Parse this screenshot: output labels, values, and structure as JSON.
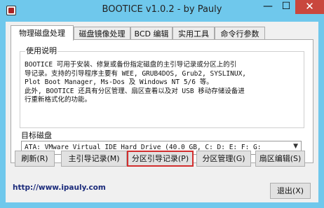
{
  "window": {
    "title": "BOOTICE v1.0.2 - by Pauly",
    "controls": {
      "minimize": "—",
      "maximize": "☐",
      "close": "✕"
    }
  },
  "tabs": [
    {
      "label": "物理磁盘处理",
      "active": true
    },
    {
      "label": "磁盘镜像处理",
      "active": false
    },
    {
      "label": "BCD 编辑",
      "active": false
    },
    {
      "label": "实用工具",
      "active": false
    },
    {
      "label": "命令行参数",
      "active": false
    }
  ],
  "usage": {
    "title": "使用说明",
    "text": "BOOTICE 可用于安装、修复或备份指定磁盘的主引导记录或分区上的引\n导记录。支持的引导程序主要有 WEE, GRUB4DOS, Grub2, SYSLINUX,\nPlot Boot Manager, Ms-Dos 及 Windows NT 5/6 等。\n此外, BOOTICE 还具有分区管理、扇区查看以及对 USB 移动存储设备进\n行重新格式化的功能。"
  },
  "target_disk": {
    "label": "目标磁盘",
    "selected": "ATA: VMware Virtual IDE Hard Drive (40.0 GB, C: D: E: F: G:"
  },
  "buttons": {
    "refresh": "刷新(R)",
    "mbr": "主引导记录(M)",
    "pbr": "分区引导记录(P)",
    "parts": "分区管理(G)",
    "sector": "扇区编辑(S)",
    "exit": "退出(X)"
  },
  "footer": {
    "link": "http://www.ipauly.com"
  },
  "colors": {
    "title_bar": "#6fc8ec",
    "close_button": "#c9473d",
    "focus_outline": "#d22e2e"
  }
}
